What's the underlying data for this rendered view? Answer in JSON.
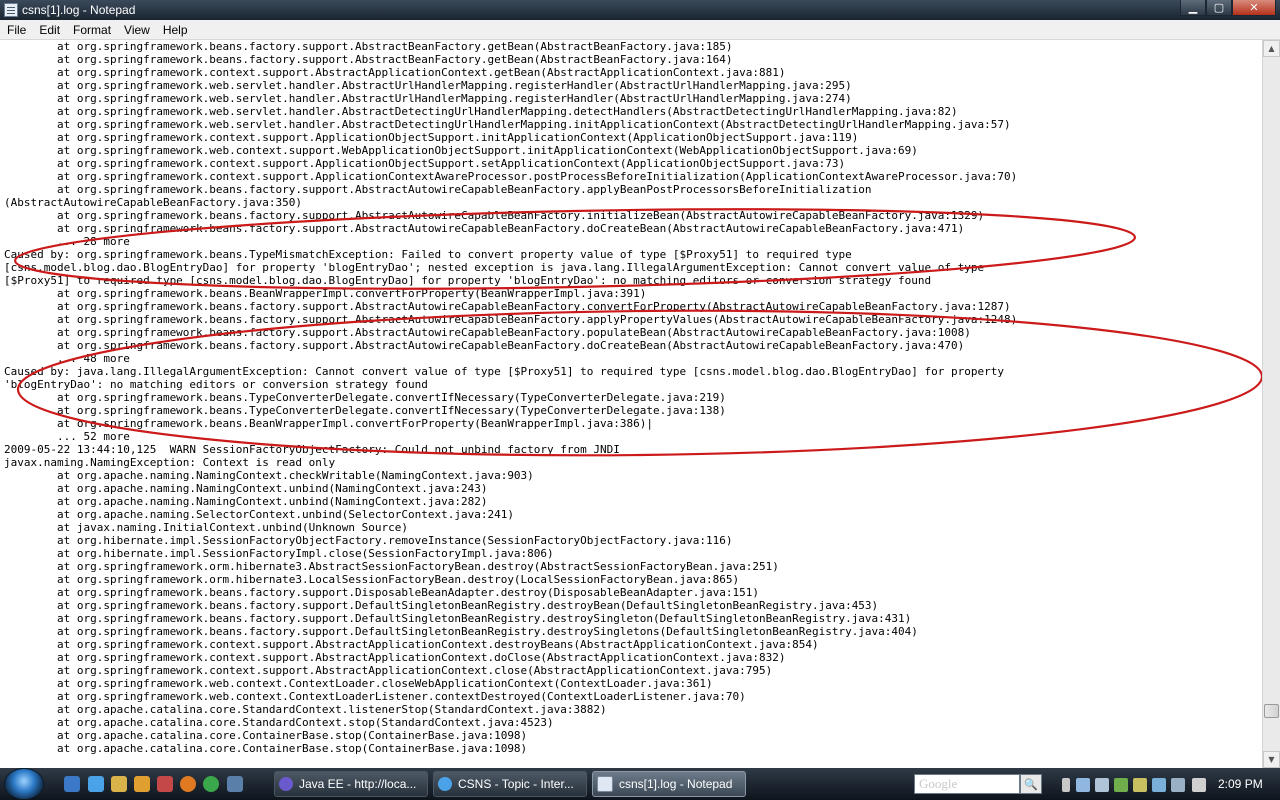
{
  "window": {
    "title": "csns[1].log - Notepad",
    "minimize_glyph": "▁",
    "maximize_glyph": "▢",
    "close_glyph": "✕"
  },
  "menu": [
    "File",
    "Edit",
    "Format",
    "View",
    "Help"
  ],
  "log_lines": [
    "\tat org.springframework.beans.factory.support.AbstractBeanFactory.getBean(AbstractBeanFactory.java:185)",
    "\tat org.springframework.beans.factory.support.AbstractBeanFactory.getBean(AbstractBeanFactory.java:164)",
    "\tat org.springframework.context.support.AbstractApplicationContext.getBean(AbstractApplicationContext.java:881)",
    "\tat org.springframework.web.servlet.handler.AbstractUrlHandlerMapping.registerHandler(AbstractUrlHandlerMapping.java:295)",
    "\tat org.springframework.web.servlet.handler.AbstractUrlHandlerMapping.registerHandler(AbstractUrlHandlerMapping.java:274)",
    "\tat org.springframework.web.servlet.handler.AbstractDetectingUrlHandlerMapping.detectHandlers(AbstractDetectingUrlHandlerMapping.java:82)",
    "\tat org.springframework.web.servlet.handler.AbstractDetectingUrlHandlerMapping.initApplicationContext(AbstractDetectingUrlHandlerMapping.java:57)",
    "\tat org.springframework.context.support.ApplicationObjectSupport.initApplicationContext(ApplicationObjectSupport.java:119)",
    "\tat org.springframework.web.context.support.WebApplicationObjectSupport.initApplicationContext(WebApplicationObjectSupport.java:69)",
    "\tat org.springframework.context.support.ApplicationObjectSupport.setApplicationContext(ApplicationObjectSupport.java:73)",
    "\tat org.springframework.context.support.ApplicationContextAwareProcessor.postProcessBeforeInitialization(ApplicationContextAwareProcessor.java:70)",
    "\tat org.springframework.beans.factory.support.AbstractAutowireCapableBeanFactory.applyBeanPostProcessorsBeforeInitialization",
    "(AbstractAutowireCapableBeanFactory.java:350)",
    "\tat org.springframework.beans.factory.support.AbstractAutowireCapableBeanFactory.initializeBean(AbstractAutowireCapableBeanFactory.java:1329)",
    "\tat org.springframework.beans.factory.support.AbstractAutowireCapableBeanFactory.doCreateBean(AbstractAutowireCapableBeanFactory.java:471)",
    "\t... 28 more",
    "Caused by: org.springframework.beans.TypeMismatchException: Failed to convert property value of type [$Proxy51] to required type",
    "[csns.model.blog.dao.BlogEntryDao] for property 'blogEntryDao'; nested exception is java.lang.IllegalArgumentException: Cannot convert value of type",
    "[$Proxy51] to required type [csns.model.blog.dao.BlogEntryDao] for property 'blogEntryDao': no matching editors or conversion strategy found",
    "\tat org.springframework.beans.BeanWrapperImpl.convertForProperty(BeanWrapperImpl.java:391)",
    "\tat org.springframework.beans.factory.support.AbstractAutowireCapableBeanFactory.convertForProperty(AbstractAutowireCapableBeanFactory.java:1287)",
    "\tat org.springframework.beans.factory.support.AbstractAutowireCapableBeanFactory.applyPropertyValues(AbstractAutowireCapableBeanFactory.java:1248)",
    "\tat org.springframework.beans.factory.support.AbstractAutowireCapableBeanFactory.populateBean(AbstractAutowireCapableBeanFactory.java:1008)",
    "\tat org.springframework.beans.factory.support.AbstractAutowireCapableBeanFactory.doCreateBean(AbstractAutowireCapableBeanFactory.java:470)",
    "\t... 48 more",
    "Caused by: java.lang.IllegalArgumentException: Cannot convert value of type [$Proxy51] to required type [csns.model.blog.dao.BlogEntryDao] for property",
    "'blogEntryDao': no matching editors or conversion strategy found",
    "\tat org.springframework.beans.TypeConverterDelegate.convertIfNecessary(TypeConverterDelegate.java:219)",
    "\tat org.springframework.beans.TypeConverterDelegate.convertIfNecessary(TypeConverterDelegate.java:138)",
    "\tat org.springframework.beans.BeanWrapperImpl.convertForProperty(BeanWrapperImpl.java:386)|",
    "\t... 52 more",
    "2009-05-22 13:44:10,125  WARN SessionFactoryObjectFactory: Could not unbind factory from JNDI",
    "javax.naming.NamingException: Context is read only",
    "\tat org.apache.naming.NamingContext.checkWritable(NamingContext.java:903)",
    "\tat org.apache.naming.NamingContext.unbind(NamingContext.java:243)",
    "\tat org.apache.naming.NamingContext.unbind(NamingContext.java:282)",
    "\tat org.apache.naming.SelectorContext.unbind(SelectorContext.java:241)",
    "\tat javax.naming.InitialContext.unbind(Unknown Source)",
    "\tat org.hibernate.impl.SessionFactoryObjectFactory.removeInstance(SessionFactoryObjectFactory.java:116)",
    "\tat org.hibernate.impl.SessionFactoryImpl.close(SessionFactoryImpl.java:806)",
    "\tat org.springframework.orm.hibernate3.AbstractSessionFactoryBean.destroy(AbstractSessionFactoryBean.java:251)",
    "\tat org.springframework.orm.hibernate3.LocalSessionFactoryBean.destroy(LocalSessionFactoryBean.java:865)",
    "\tat org.springframework.beans.factory.support.DisposableBeanAdapter.destroy(DisposableBeanAdapter.java:151)",
    "\tat org.springframework.beans.factory.support.DefaultSingletonBeanRegistry.destroyBean(DefaultSingletonBeanRegistry.java:453)",
    "\tat org.springframework.beans.factory.support.DefaultSingletonBeanRegistry.destroySingleton(DefaultSingletonBeanRegistry.java:431)",
    "\tat org.springframework.beans.factory.support.DefaultSingletonBeanRegistry.destroySingletons(DefaultSingletonBeanRegistry.java:404)",
    "\tat org.springframework.context.support.AbstractApplicationContext.destroyBeans(AbstractApplicationContext.java:854)",
    "\tat org.springframework.context.support.AbstractApplicationContext.doClose(AbstractApplicationContext.java:832)",
    "\tat org.springframework.context.support.AbstractApplicationContext.close(AbstractApplicationContext.java:795)",
    "\tat org.springframework.web.context.ContextLoader.closeWebApplicationContext(ContextLoader.java:361)",
    "\tat org.springframework.web.context.ContextLoaderListener.contextDestroyed(ContextLoaderListener.java:70)",
    "\tat org.apache.catalina.core.StandardContext.listenerStop(StandardContext.java:3882)",
    "\tat org.apache.catalina.core.StandardContext.stop(StandardContext.java:4523)",
    "\tat org.apache.catalina.core.ContainerBase.stop(ContainerBase.java:1098)",
    "\tat org.apache.catalina.core.ContainerBase.stop(ContainerBase.java:1098)"
  ],
  "scrollbar": {
    "up_glyph": "▲",
    "down_glyph": "▼"
  },
  "annotation_color": "#cc1a1a",
  "taskbar": {
    "quick_launch_icons": [
      "switch-user-icon",
      "internet-explorer-icon",
      "windows-explorer-icon",
      "media-player-icon",
      "paint-icon",
      "firefox-icon",
      "chrome-icon",
      "show-desktop-icon"
    ],
    "tasks": [
      {
        "label": "Java EE - http://loca...",
        "icon": "eclipse-icon",
        "active": false
      },
      {
        "label": "CSNS - Topic - Inter...",
        "icon": "internet-explorer-icon",
        "active": false
      },
      {
        "label": "csns[1].log - Notepad",
        "icon": "notepad-icon",
        "active": true
      }
    ],
    "search_placeholder": "Google",
    "search_glyph": "🔍",
    "clock": "2:09 PM"
  }
}
